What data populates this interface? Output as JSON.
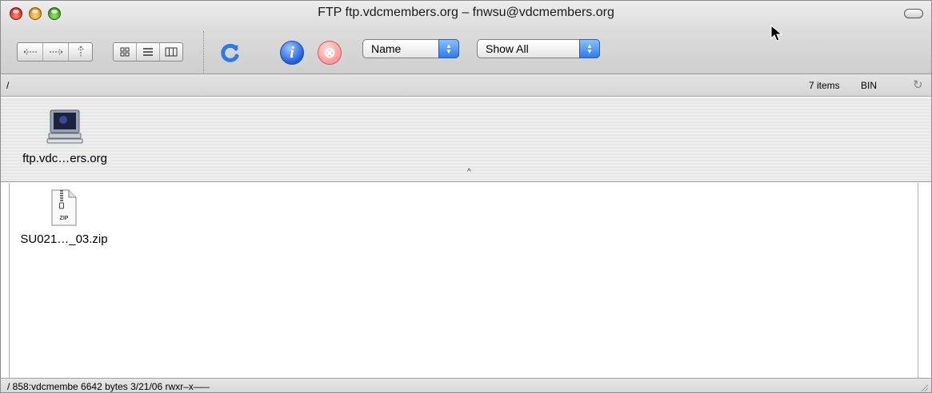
{
  "window": {
    "title": "FTP ftp.vdcmembers.org – fnwsu@vdcmembers.org"
  },
  "toolbar": {
    "sort_popup": {
      "selected": "Name"
    },
    "filter_popup": {
      "selected": "Show All"
    },
    "info_icon_glyph": "i",
    "stop_icon_glyph": "⊗"
  },
  "pathbar": {
    "path": "/",
    "item_count": "7 items",
    "transfer_mode": "BIN"
  },
  "host": {
    "label": "ftp.vdc…ers.org"
  },
  "files": [
    {
      "name": "SU021…_03.zip",
      "badge": "ZIP"
    }
  ],
  "statusbar": {
    "text": "/  858:vdcmembe  6642 bytes  3/21/06  rwxr–x–––"
  }
}
